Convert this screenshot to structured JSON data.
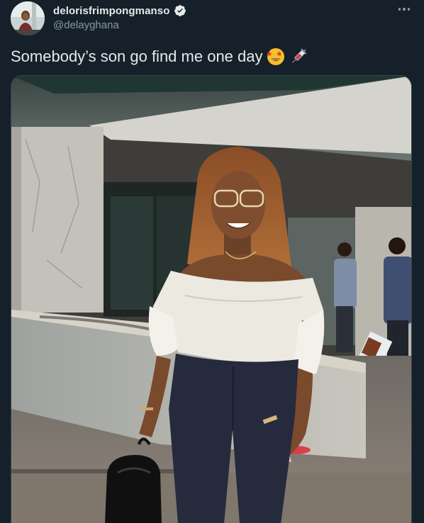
{
  "tweet": {
    "display_name": "delorisfrimpongmanso",
    "handle": "@delayghana",
    "text": "Somebody’s son go find me one day",
    "emojis": [
      "star-struck-emoji",
      "syringe-emoji"
    ],
    "verified": true
  },
  "icons": {
    "verified": "verified-badge-icon",
    "more": "more-options-icon"
  },
  "colors": {
    "background": "#15202b",
    "primary_text": "#e7e9ea",
    "secondary_text": "#8b98a5",
    "border": "#38444d"
  }
}
